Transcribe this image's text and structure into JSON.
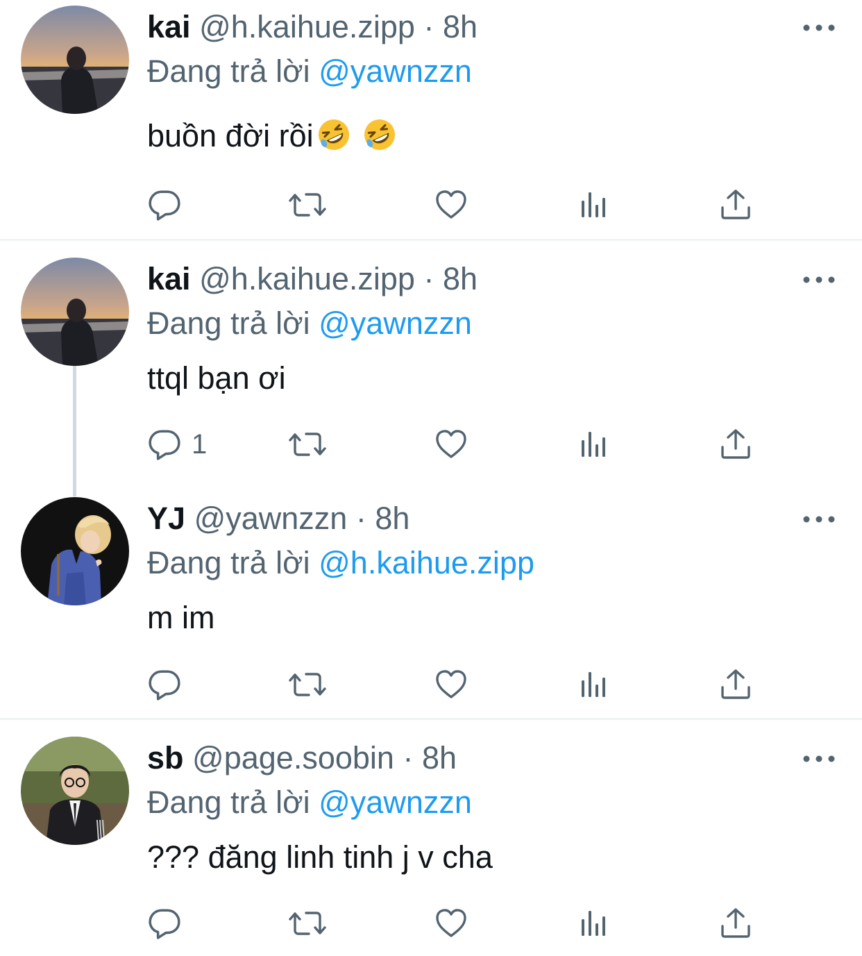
{
  "tweets": [
    {
      "name": "kai",
      "handle": "@h.kaihue.zipp",
      "separator": " · ",
      "time": "8h",
      "reply_prefix": "Đang trả lời ",
      "reply_to": "@yawnzzn",
      "text": "buồn đời rồi",
      "emoji": [
        "🤣",
        "🤣"
      ],
      "reply_count": ""
    },
    {
      "name": "kai",
      "handle": "@h.kaihue.zipp",
      "separator": " · ",
      "time": "8h",
      "reply_prefix": "Đang trả lời ",
      "reply_to": "@yawnzzn",
      "text": "ttql bạn ơi",
      "reply_count": "1"
    },
    {
      "name": "YJ",
      "handle": "@yawnzzn",
      "separator": " · ",
      "time": "8h",
      "reply_prefix": "Đang trả lời ",
      "reply_to": "@h.kaihue.zipp",
      "text": "m im",
      "reply_count": ""
    },
    {
      "name": "sb",
      "handle": "@page.soobin",
      "separator": " · ",
      "time": "8h",
      "reply_prefix": "Đang trả lời ",
      "reply_to": "@yawnzzn",
      "text": "??? đăng linh tinh j v cha",
      "reply_count": ""
    }
  ],
  "icons": {
    "more": "more-dots-icon",
    "reply": "reply-bubble-icon",
    "retweet": "retweet-icon",
    "like": "heart-icon",
    "views": "analytics-bars-icon",
    "share": "share-upload-icon"
  },
  "colors": {
    "text": "#0f1419",
    "secondary": "#536471",
    "link": "#1d9bf0",
    "divider": "#eff3f4",
    "thread_line": "#cfd9de"
  }
}
